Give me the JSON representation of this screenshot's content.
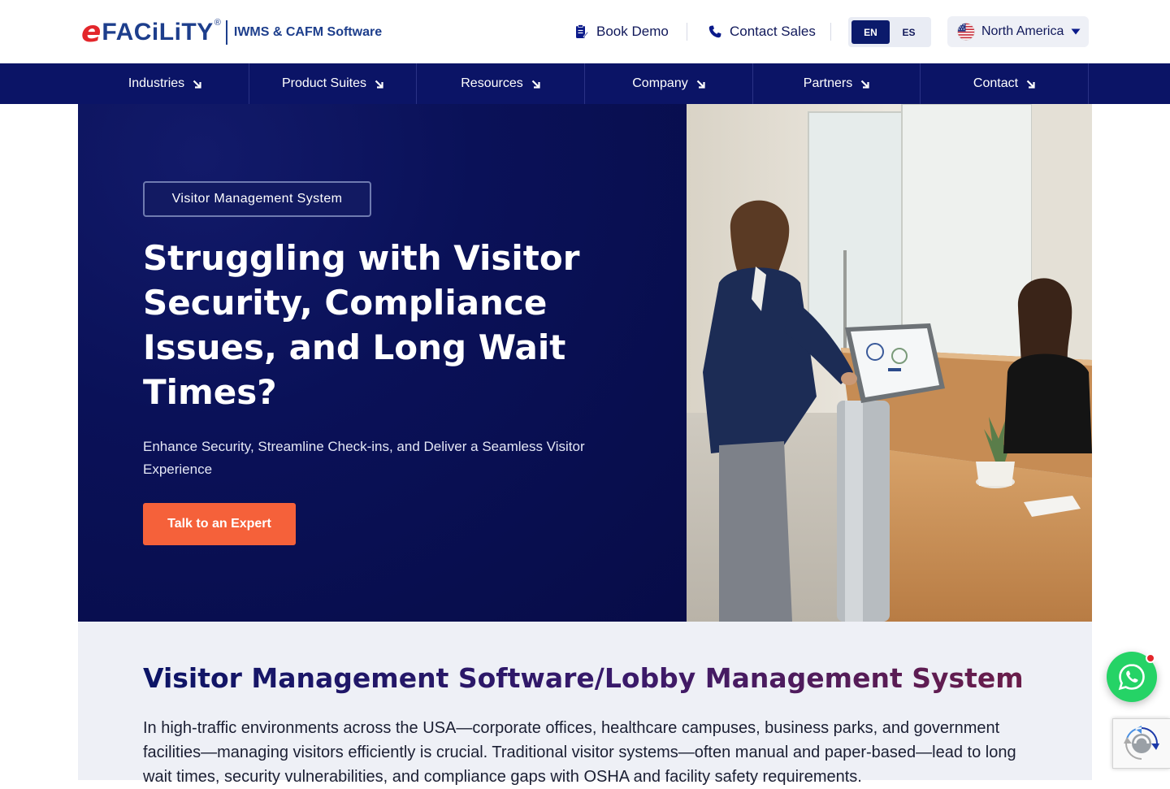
{
  "header": {
    "logo_e": "e",
    "logo_word": "FACiLiTY",
    "logo_reg": "®",
    "logo_tagline": "IWMS & CAFM Software",
    "book_demo": "Book Demo",
    "contact_sales": "Contact Sales",
    "languages": [
      "EN",
      "ES"
    ],
    "active_language": "EN",
    "region": "North America"
  },
  "nav": {
    "items": [
      "Industries",
      "Product Suites",
      "Resources",
      "Company",
      "Partners",
      "Contact"
    ]
  },
  "hero": {
    "badge": "Visitor Management System",
    "title": "Struggling with Visitor Security, Compliance Issues, and Long Wait Times?",
    "subtitle": "Enhance Security, Streamline Check-ins, and Deliver a Seamless Visitor Experience",
    "cta": "Talk to an Expert"
  },
  "content": {
    "title": "Visitor Management Software/Lobby Management System",
    "body": "In high-traffic environments across the USA—corporate offices, healthcare campuses, business parks, and government facilities—managing visitors efficiently is crucial. Traditional visitor systems—often manual and paper-based—lead to long wait times, security vulnerabilities, and compliance gaps with OSHA and facility safety requirements."
  },
  "colors": {
    "navy": "#0b1466",
    "accent": "#f5613a",
    "brand_red": "#e3262b",
    "brand_blue": "#1d3e8c",
    "whatsapp": "#25d366"
  }
}
